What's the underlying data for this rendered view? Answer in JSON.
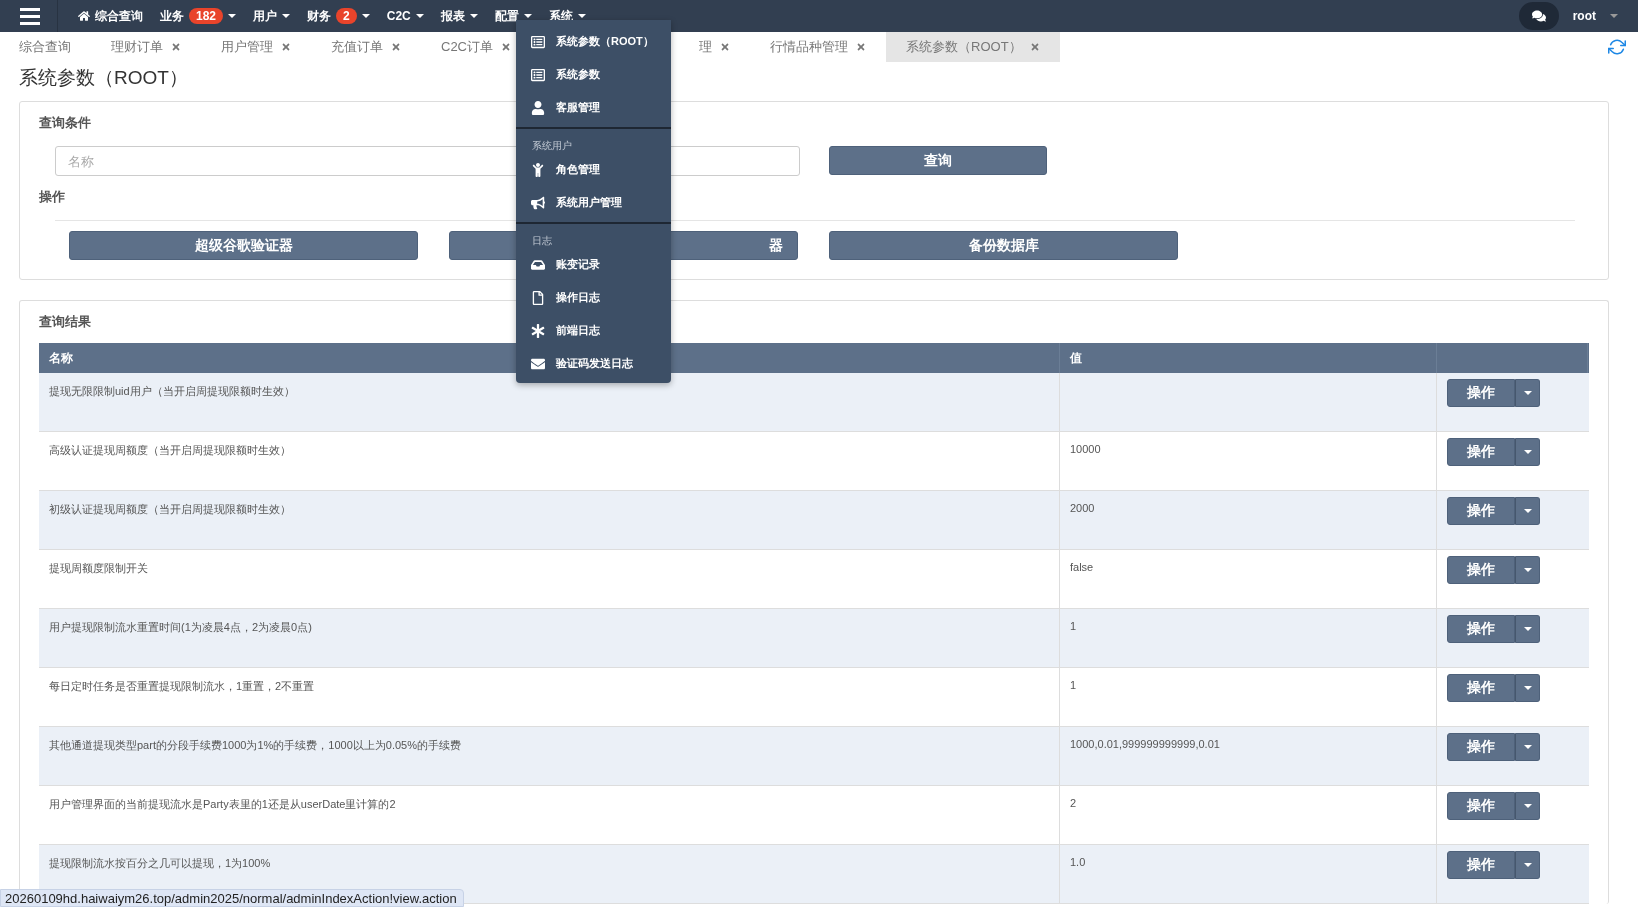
{
  "nav": {
    "items": [
      {
        "label": "综合查询",
        "home": true,
        "caret": false,
        "expanded": false
      },
      {
        "label": "业务",
        "badge": "182",
        "caret": true,
        "expanded": false
      },
      {
        "label": "用户",
        "caret": true,
        "expanded": false
      },
      {
        "label": "财务",
        "badge": "2",
        "caret": true,
        "expanded": false
      },
      {
        "label": "C2C",
        "caret": true,
        "expanded": false
      },
      {
        "label": "报表",
        "caret": true,
        "expanded": false
      },
      {
        "label": "配置",
        "caret": true,
        "expanded": false
      },
      {
        "label": "系统",
        "caret": true,
        "expanded": true
      }
    ],
    "user": "root"
  },
  "tabs": [
    {
      "label": "综合查询",
      "closable": false,
      "selected": false
    },
    {
      "label": "理财订单",
      "closable": true,
      "selected": false
    },
    {
      "label": "用户管理",
      "closable": true,
      "selected": false
    },
    {
      "label": "充值订单",
      "closable": true,
      "selected": false
    },
    {
      "label": "C2C订单",
      "closable": true,
      "selected": false
    },
    {
      "label": "理",
      "closable": true,
      "selected": false,
      "kind": "covered"
    },
    {
      "label": "行情品种管理",
      "closable": true,
      "selected": false
    },
    {
      "label": "系统参数（ROOT）",
      "closable": true,
      "selected": true
    }
  ],
  "page_title": "系统参数（ROOT）",
  "query_panel": {
    "title": "查询条件",
    "search": {
      "placeholder": "名称"
    },
    "query_button": "查询",
    "ops_title": "操作",
    "ops_buttons": [
      {
        "label": "超级谷歌验证器"
      },
      {
        "label": "器",
        "kind": "covered"
      },
      {
        "label": "备份数据库"
      }
    ]
  },
  "results": {
    "title": "查询结果",
    "columns": [
      "名称",
      "值"
    ],
    "rows": [
      {
        "name": "提现无限限制uid用户（当开启周提现限额时生效）",
        "value": "",
        "action": "操作"
      },
      {
        "name": "高级认证提现周额度（当开启周提现限额时生效）",
        "value": "10000",
        "action": "操作"
      },
      {
        "name": "初级认证提现周额度（当开启周提现限额时生效）",
        "value": "2000",
        "action": "操作"
      },
      {
        "name": "提现周额度限制开关",
        "value": "false",
        "action": "操作"
      },
      {
        "name": "用户提现限制流水重置时间(1为凌晨4点，2为凌晨0点)",
        "value": "1",
        "action": "操作"
      },
      {
        "name": "每日定时任务是否重置提现限制流水，1重置，2不重置",
        "value": "1",
        "action": "操作"
      },
      {
        "name": "其他通道提现类型part的分段手续费1000为1%的手续费，1000以上为0.05%的手续费",
        "value": "1000,0.01,999999999999,0.01",
        "action": "操作"
      },
      {
        "name": "用户管理界面的当前提现流水是Party表里的1还是从userDate里计算的2",
        "value": "2",
        "action": "操作"
      },
      {
        "name": "提现限制流水按百分之几可以提现，1为100%",
        "value": "1.0",
        "action": "操作"
      }
    ]
  },
  "system_menu": {
    "sections": [
      {
        "items": [
          "系统参数（ROOT）",
          "系统参数",
          "客服管理"
        ]
      },
      {
        "header": "系统用户",
        "items": [
          "角色管理",
          "系统用户管理"
        ]
      },
      {
        "header": "日志",
        "items": [
          "账变记录",
          "操作日志",
          "前端日志",
          "验证码发送日志"
        ]
      }
    ]
  },
  "status_url": "20260109hd.haiwaiym26.top/admin2025/normal/adminIndexAction!view.action"
}
